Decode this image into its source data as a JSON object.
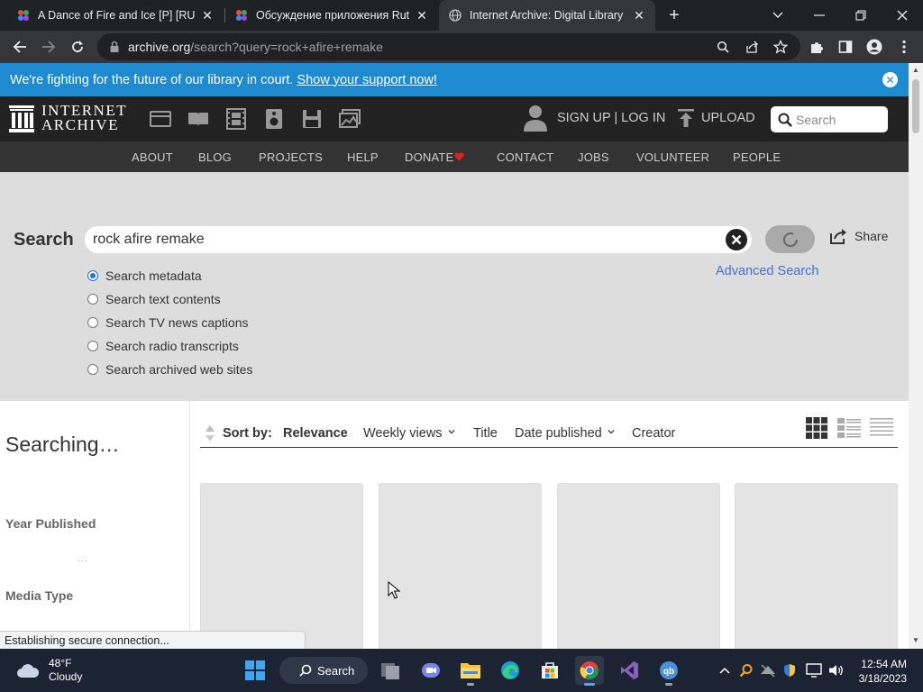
{
  "browser": {
    "tabs": [
      {
        "title": "A Dance of Fire and Ice [P] [RUS",
        "active": false
      },
      {
        "title": "Обсуждение приложения Rutra",
        "active": false
      },
      {
        "title": "Internet Archive: Digital Library o",
        "active": true
      }
    ],
    "url_host": "archive.org",
    "url_path": "/search?query=rock+afire+remake"
  },
  "banner": {
    "text": "We're fighting for the future of our library in court.",
    "link": "Show your support now!"
  },
  "header": {
    "logo_line1": "INTERNET",
    "logo_line2": "ARCHIVE",
    "signup_login": "SIGN UP | LOG IN",
    "upload": "UPLOAD",
    "search_placeholder": "Search"
  },
  "nav": [
    "ABOUT",
    "BLOG",
    "PROJECTS",
    "HELP",
    "DONATE",
    "CONTACT",
    "JOBS",
    "VOLUNTEER",
    "PEOPLE"
  ],
  "search": {
    "label": "Search",
    "query": "rock afire remake",
    "share": "Share",
    "advanced": "Advanced Search",
    "options": [
      {
        "label": "Search metadata",
        "checked": true
      },
      {
        "label": "Search text contents",
        "checked": false
      },
      {
        "label": "Search TV news captions",
        "checked": false
      },
      {
        "label": "Search radio transcripts",
        "checked": false
      },
      {
        "label": "Search archived web sites",
        "checked": false
      }
    ]
  },
  "sidebar": {
    "status": "Searching…",
    "facets": [
      "Year Published",
      "Media Type"
    ],
    "loading": "..."
  },
  "sort": {
    "label": "Sort by:",
    "options": [
      "Relevance",
      "Weekly views",
      "Title",
      "Date published",
      "Creator"
    ]
  },
  "statusbar": "Establishing secure connection...",
  "taskbar": {
    "temp": "48°F",
    "weather": "Cloudy",
    "search": "Search",
    "time": "12:54 AM",
    "date": "3/18/2023"
  },
  "colors": {
    "banner": "#1e8bd1",
    "header": "#222222",
    "nav": "#333333",
    "search_panel": "#dddddd",
    "link": "#4271cf",
    "donate_heart": "#e42020"
  }
}
